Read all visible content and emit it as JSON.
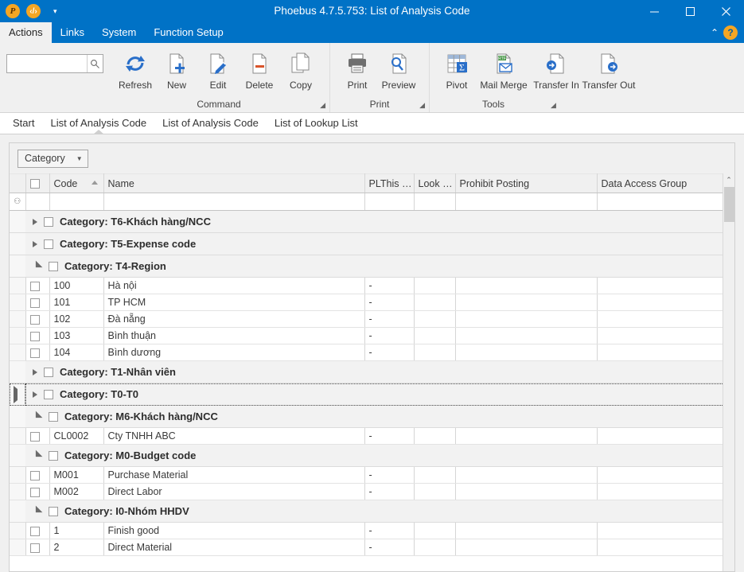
{
  "window": {
    "title": "Phoebus 4.7.5.753: List of Analysis Code",
    "quick_access": [
      {
        "name": "phoebus-logo-icon",
        "glyph": "P"
      },
      {
        "name": "code-icon",
        "glyph": "‹/›"
      },
      {
        "name": "customize-quick-access-caret-icon",
        "glyph": "▾"
      }
    ],
    "controls": {
      "minimize": "minimize-button",
      "maximize": "maximize-button",
      "close": "close-button"
    },
    "accent_color": "#0072c6",
    "ribbon_bg": "#f0f0f0"
  },
  "menu": {
    "tabs": [
      {
        "label": "Actions",
        "active": true
      },
      {
        "label": "Links",
        "active": false
      },
      {
        "label": "System",
        "active": false
      },
      {
        "label": "Function Setup",
        "active": false
      }
    ],
    "collapse_label": "⌃",
    "help_label": "?"
  },
  "search": {
    "value": "",
    "placeholder": "",
    "icon": "search-icon"
  },
  "ribbon": {
    "groups": [
      {
        "name": "Command",
        "label": "Command",
        "has_launcher": true,
        "buttons": [
          {
            "label": "Refresh",
            "icon": "refresh-icon"
          },
          {
            "label": "New",
            "icon": "new-document-icon"
          },
          {
            "label": "Edit",
            "icon": "edit-pencil-icon"
          },
          {
            "label": "Delete",
            "icon": "delete-document-icon"
          },
          {
            "label": "Copy",
            "icon": "copy-icon"
          }
        ]
      },
      {
        "name": "Print",
        "label": "Print",
        "has_launcher": true,
        "buttons": [
          {
            "label": "Print",
            "icon": "printer-icon"
          },
          {
            "label": "Preview",
            "icon": "print-preview-icon"
          }
        ]
      },
      {
        "name": "Tools",
        "label": "Tools",
        "has_launcher": true,
        "buttons": [
          {
            "label": "Pivot",
            "icon": "pivot-table-icon"
          },
          {
            "label": "Mail Merge",
            "icon": "mail-merge-icon"
          },
          {
            "label": "Transfer In",
            "icon": "transfer-in-icon"
          },
          {
            "label": "Transfer Out",
            "icon": "transfer-out-icon"
          }
        ]
      }
    ]
  },
  "doc_tabs": [
    {
      "label": "Start",
      "active": false
    },
    {
      "label": "List of Analysis Code",
      "active": true
    },
    {
      "label": "List of Analysis Code",
      "active": false
    },
    {
      "label": "List of Lookup List",
      "active": false
    }
  ],
  "panel": {
    "group_by": {
      "label": "Category",
      "arrow": "▾"
    },
    "columns": [
      {
        "key": "indicator",
        "label": "",
        "class": "col-ind"
      },
      {
        "key": "check",
        "label": "",
        "class": "col-chk"
      },
      {
        "key": "code",
        "label": "Code",
        "class": "col-code",
        "sorted": "asc"
      },
      {
        "key": "name",
        "label": "Name",
        "class": "col-name"
      },
      {
        "key": "plthis",
        "label": "PLThis …",
        "class": "col-pl"
      },
      {
        "key": "look",
        "label": "Look …",
        "class": "col-look"
      },
      {
        "key": "prohibit",
        "label": "Prohibit Posting",
        "class": "col-prohibit"
      },
      {
        "key": "dag",
        "label": "Data Access Group",
        "class": "col-dag"
      }
    ],
    "filter_row_glyph": "⚇",
    "rows": [
      {
        "type": "group",
        "label": "Category: T6-Khách hàng/NCC",
        "expanded": false,
        "focused": false
      },
      {
        "type": "group",
        "label": "Category: T5-Expense code",
        "expanded": false,
        "focused": false
      },
      {
        "type": "group",
        "label": "Category: T4-Region",
        "expanded": true,
        "focused": false
      },
      {
        "type": "data",
        "code": "100",
        "name": "Hà nội",
        "plthis": "-",
        "look": "",
        "prohibit": "",
        "dag": ""
      },
      {
        "type": "data",
        "code": "101",
        "name": "TP HCM",
        "plthis": "-",
        "look": "",
        "prohibit": "",
        "dag": ""
      },
      {
        "type": "data",
        "code": "102",
        "name": "Đà nẵng",
        "plthis": "-",
        "look": "",
        "prohibit": "",
        "dag": ""
      },
      {
        "type": "data",
        "code": "103",
        "name": "Bình thuận",
        "plthis": "-",
        "look": "",
        "prohibit": "",
        "dag": ""
      },
      {
        "type": "data",
        "code": "104",
        "name": "Bình dương",
        "plthis": "-",
        "look": "",
        "prohibit": "",
        "dag": ""
      },
      {
        "type": "group",
        "label": "Category: T1-Nhân viên",
        "expanded": false,
        "focused": false
      },
      {
        "type": "group",
        "label": "Category: T0-T0",
        "expanded": false,
        "focused": true
      },
      {
        "type": "group",
        "label": "Category: M6-Khách hàng/NCC",
        "expanded": true,
        "focused": false
      },
      {
        "type": "data",
        "code": "CL0002",
        "name": "Cty TNHH ABC",
        "plthis": "-",
        "look": "",
        "prohibit": "",
        "dag": ""
      },
      {
        "type": "group",
        "label": "Category: M0-Budget code",
        "expanded": true,
        "focused": false
      },
      {
        "type": "data",
        "code": "M001",
        "name": "Purchase Material",
        "plthis": "-",
        "look": "",
        "prohibit": "",
        "dag": ""
      },
      {
        "type": "data",
        "code": "M002",
        "name": "Direct Labor",
        "plthis": "-",
        "look": "",
        "prohibit": "",
        "dag": ""
      },
      {
        "type": "group",
        "label": "Category: I0-Nhóm HHDV",
        "expanded": true,
        "focused": false
      },
      {
        "type": "data",
        "code": "1",
        "name": "Finish good",
        "plthis": "-",
        "look": "",
        "prohibit": "",
        "dag": ""
      },
      {
        "type": "data",
        "code": "2",
        "name": "Direct Material",
        "plthis": "-",
        "look": "",
        "prohibit": "",
        "dag": ""
      }
    ],
    "scrollbar": {
      "up_arrow": "⌃",
      "thumb_position_pct": 2
    }
  }
}
